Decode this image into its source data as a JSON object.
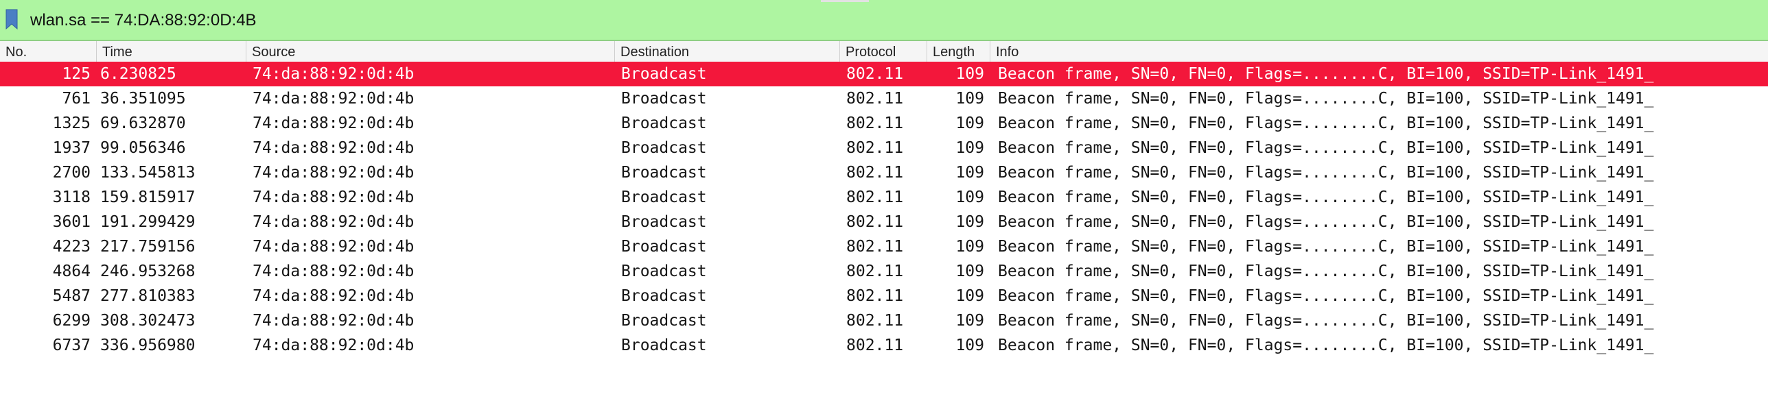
{
  "filter": {
    "value": "wlan.sa == 74:DA:88:92:0D:4B",
    "bookmark_icon": "bookmark-icon",
    "color": "#aef5a1"
  },
  "columns": {
    "no": "No.",
    "time": "Time",
    "source": "Source",
    "destination": "Destination",
    "protocol": "Protocol",
    "length": "Length",
    "info": "Info"
  },
  "selected_row_color": "#f3173b",
  "packets": [
    {
      "no": "125",
      "time": "6.230825",
      "source": "74:da:88:92:0d:4b",
      "destination": "Broadcast",
      "protocol": "802.11",
      "length": "109",
      "info": "Beacon frame, SN=0, FN=0, Flags=........C, BI=100, SSID=TP-Link_1491_",
      "selected": true
    },
    {
      "no": "761",
      "time": "36.351095",
      "source": "74:da:88:92:0d:4b",
      "destination": "Broadcast",
      "protocol": "802.11",
      "length": "109",
      "info": "Beacon frame, SN=0, FN=0, Flags=........C, BI=100, SSID=TP-Link_1491_"
    },
    {
      "no": "1325",
      "time": "69.632870",
      "source": "74:da:88:92:0d:4b",
      "destination": "Broadcast",
      "protocol": "802.11",
      "length": "109",
      "info": "Beacon frame, SN=0, FN=0, Flags=........C, BI=100, SSID=TP-Link_1491_"
    },
    {
      "no": "1937",
      "time": "99.056346",
      "source": "74:da:88:92:0d:4b",
      "destination": "Broadcast",
      "protocol": "802.11",
      "length": "109",
      "info": "Beacon frame, SN=0, FN=0, Flags=........C, BI=100, SSID=TP-Link_1491_"
    },
    {
      "no": "2700",
      "time": "133.545813",
      "source": "74:da:88:92:0d:4b",
      "destination": "Broadcast",
      "protocol": "802.11",
      "length": "109",
      "info": "Beacon frame, SN=0, FN=0, Flags=........C, BI=100, SSID=TP-Link_1491_"
    },
    {
      "no": "3118",
      "time": "159.815917",
      "source": "74:da:88:92:0d:4b",
      "destination": "Broadcast",
      "protocol": "802.11",
      "length": "109",
      "info": "Beacon frame, SN=0, FN=0, Flags=........C, BI=100, SSID=TP-Link_1491_"
    },
    {
      "no": "3601",
      "time": "191.299429",
      "source": "74:da:88:92:0d:4b",
      "destination": "Broadcast",
      "protocol": "802.11",
      "length": "109",
      "info": "Beacon frame, SN=0, FN=0, Flags=........C, BI=100, SSID=TP-Link_1491_"
    },
    {
      "no": "4223",
      "time": "217.759156",
      "source": "74:da:88:92:0d:4b",
      "destination": "Broadcast",
      "protocol": "802.11",
      "length": "109",
      "info": "Beacon frame, SN=0, FN=0, Flags=........C, BI=100, SSID=TP-Link_1491_"
    },
    {
      "no": "4864",
      "time": "246.953268",
      "source": "74:da:88:92:0d:4b",
      "destination": "Broadcast",
      "protocol": "802.11",
      "length": "109",
      "info": "Beacon frame, SN=0, FN=0, Flags=........C, BI=100, SSID=TP-Link_1491_"
    },
    {
      "no": "5487",
      "time": "277.810383",
      "source": "74:da:88:92:0d:4b",
      "destination": "Broadcast",
      "protocol": "802.11",
      "length": "109",
      "info": "Beacon frame, SN=0, FN=0, Flags=........C, BI=100, SSID=TP-Link_1491_"
    },
    {
      "no": "6299",
      "time": "308.302473",
      "source": "74:da:88:92:0d:4b",
      "destination": "Broadcast",
      "protocol": "802.11",
      "length": "109",
      "info": "Beacon frame, SN=0, FN=0, Flags=........C, BI=100, SSID=TP-Link_1491_"
    },
    {
      "no": "6737",
      "time": "336.956980",
      "source": "74:da:88:92:0d:4b",
      "destination": "Broadcast",
      "protocol": "802.11",
      "length": "109",
      "info": "Beacon frame, SN=0, FN=0, Flags=........C, BI=100, SSID=TP-Link_1491_"
    }
  ]
}
